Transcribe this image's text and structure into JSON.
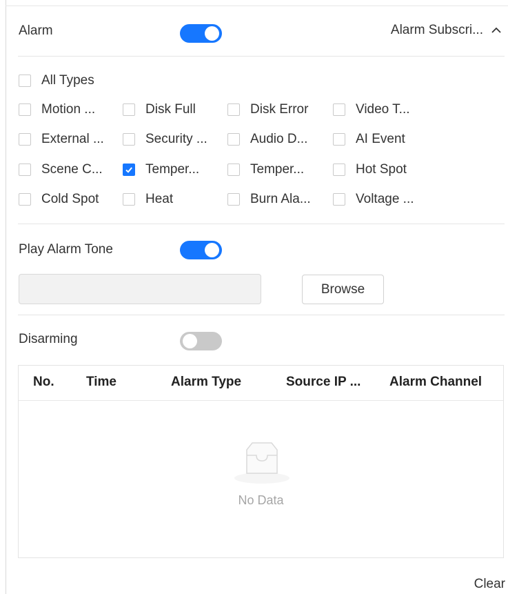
{
  "alarm": {
    "label": "Alarm",
    "toggle_on": true,
    "subscription_label": "Alarm Subscri...",
    "types": [
      {
        "label": "All Types",
        "checked": false
      },
      {
        "label": "Motion ...",
        "checked": false
      },
      {
        "label": "Disk Full",
        "checked": false
      },
      {
        "label": "Disk Error",
        "checked": false
      },
      {
        "label": "Video T...",
        "checked": false
      },
      {
        "label": "External ...",
        "checked": false
      },
      {
        "label": "Security ...",
        "checked": false
      },
      {
        "label": "Audio D...",
        "checked": false
      },
      {
        "label": "AI Event",
        "checked": false
      },
      {
        "label": "Scene C...",
        "checked": false
      },
      {
        "label": "Temper...",
        "checked": true
      },
      {
        "label": "Temper...",
        "checked": false
      },
      {
        "label": "Hot Spot",
        "checked": false
      },
      {
        "label": "Cold Spot",
        "checked": false
      },
      {
        "label": "Heat",
        "checked": false
      },
      {
        "label": "Burn Ala...",
        "checked": false
      },
      {
        "label": "Voltage ...",
        "checked": false
      }
    ]
  },
  "tone": {
    "label": "Play Alarm Tone",
    "toggle_on": true,
    "file_value": "",
    "browse_label": "Browse"
  },
  "disarming": {
    "label": "Disarming",
    "toggle_on": false
  },
  "table": {
    "columns": [
      "No.",
      "Time",
      "Alarm Type",
      "Source IP ...",
      "Alarm Channel"
    ],
    "rows": [],
    "empty_text": "No Data"
  },
  "footer": {
    "clear_label": "Clear"
  },
  "colors": {
    "accent": "#1677ff",
    "toggle_off": "#c9c9c9",
    "divider": "#e5e5e5"
  },
  "icons": {
    "collapse": "chevron-up-icon",
    "check": "check-icon",
    "empty": "empty-inbox-icon"
  }
}
